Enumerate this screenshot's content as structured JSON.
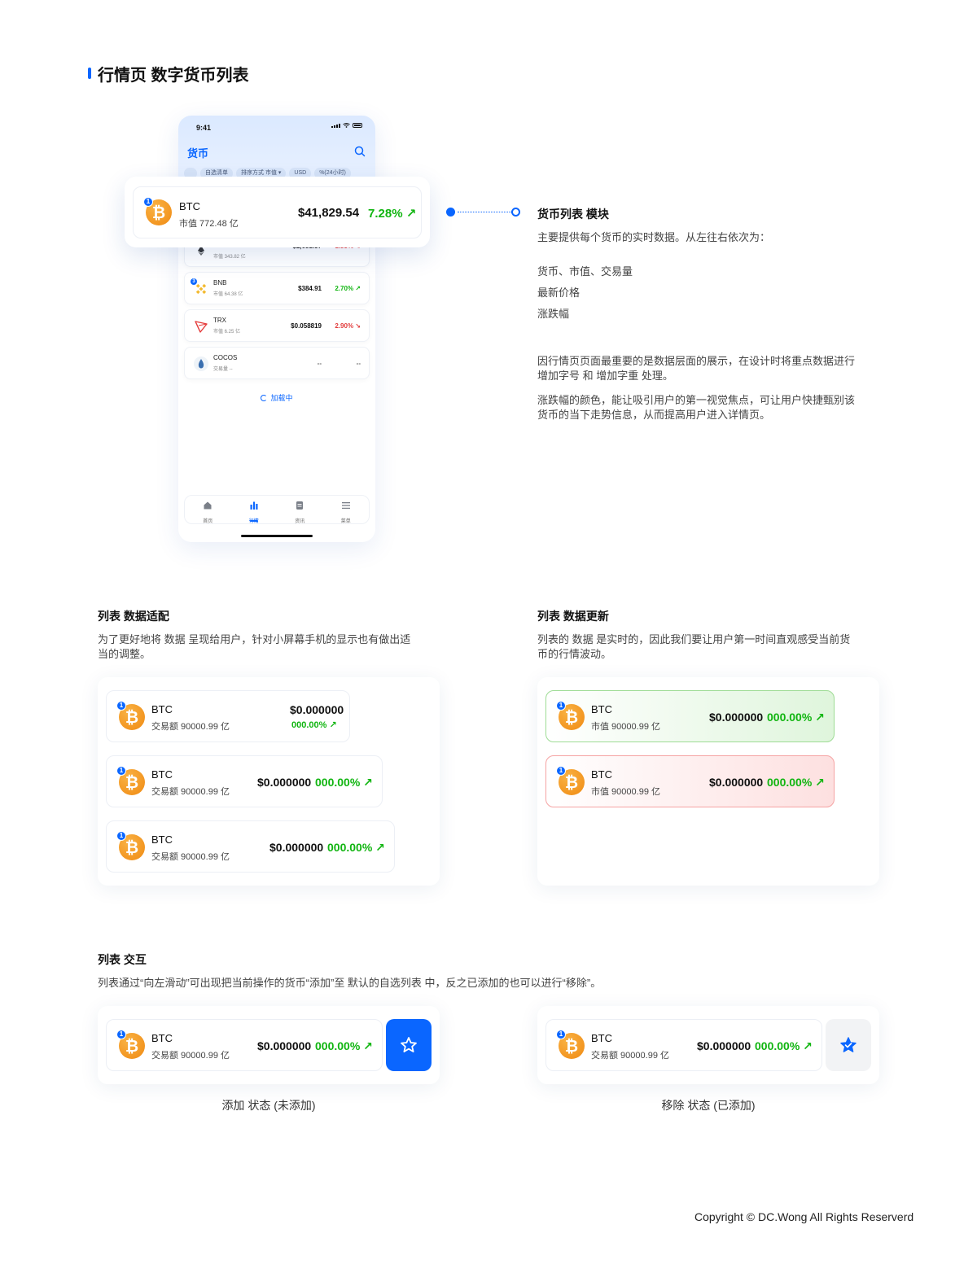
{
  "section_title": "行情页 数字货币列表",
  "phone": {
    "status_time": "9:41",
    "title": "货币",
    "chips": [
      "自选清单",
      "排序方式 市值 ▾",
      "USD",
      "%(24小时)"
    ],
    "rows": [
      {
        "name": "",
        "sub": "市值 343.82 亿",
        "price": "$2,681.37",
        "change": "1.83%",
        "arrow": "↘",
        "direction": "down"
      },
      {
        "name": "BNB",
        "sub": "市值 64.38 亿",
        "price": "$384.91",
        "change": "2.70%",
        "arrow": "↗",
        "direction": "up",
        "badge": "3"
      },
      {
        "name": "TRX",
        "sub": "市值 6.25 亿",
        "price": "$0.058819",
        "change": "2.90%",
        "arrow": "↘",
        "direction": "down"
      },
      {
        "name": "COCOS",
        "sub": "交易量 --",
        "price": "--",
        "change": "--",
        "arrow": "",
        "direction": "none"
      }
    ],
    "loading": "加载中",
    "tabs": [
      "首页",
      "行情",
      "资讯",
      "菜单"
    ]
  },
  "highlight": {
    "badge": "1",
    "name": "BTC",
    "sub": "市值 772.48 亿",
    "price": "$41,829.54",
    "change": "7.28%",
    "arrow": "↗"
  },
  "module": {
    "title": "货币列表 模块",
    "intro": "主要提供每个货币的实时数据。从左往右依次为：",
    "items": [
      "货币、市值、交易量",
      "最新价格",
      "涨跌幅"
    ],
    "para1_line1": "因行情页页面最重要的是数据层面的展示，在设计时将重点数据进行",
    "para1_line2": "增加字号 和 增加字重 处理。",
    "para2_line1": "涨跌幅的颜色，能让吸引用户的第一视觉焦点，可让用户快捷甄别该",
    "para2_line2": "货币的当下走势信息，从而提高用户进入详情页。"
  },
  "adapt": {
    "title": "列表 数据适配",
    "desc_line1": "为了更好地将 数据 呈现给用户，针对小屏幕手机的显示也有做出适",
    "desc_line2": "当的调整。",
    "name": "BTC",
    "sub": "交易额 90000.99 亿",
    "price": "$0.000000",
    "change": "000.00%",
    "arrow": "↗",
    "badge": "1"
  },
  "update": {
    "title": "列表 数据更新",
    "desc_line1": "列表的 数据 是实时的，因此我们要让用户第一时间直观感受当前货",
    "desc_line2": "币的行情波动。",
    "name": "BTC",
    "sub": "市值 90000.99 亿",
    "price": "$0.000000",
    "change": "000.00%",
    "arrow": "↗",
    "badge": "1"
  },
  "interact": {
    "title": "列表 交互",
    "desc": "列表通过“向左滑动”可出现把当前操作的货币“添加”至 默认的自选列表 中，反之已添加的也可以进行“移除”。",
    "name": "BTC",
    "sub": "交易额 90000.99 亿",
    "price": "$0.000000",
    "change": "000.00%",
    "arrow": "↗",
    "badge": "1",
    "caption_add": "添加 状态 (未添加)",
    "caption_remove": "移除 状态 (已添加)"
  },
  "copyright": "Copyright © DC.Wong All Rights Reserverd",
  "colors": {
    "accent": "#0a66ff",
    "up": "#11b511",
    "down": "#e23b3b",
    "btc": "#f7931a"
  }
}
